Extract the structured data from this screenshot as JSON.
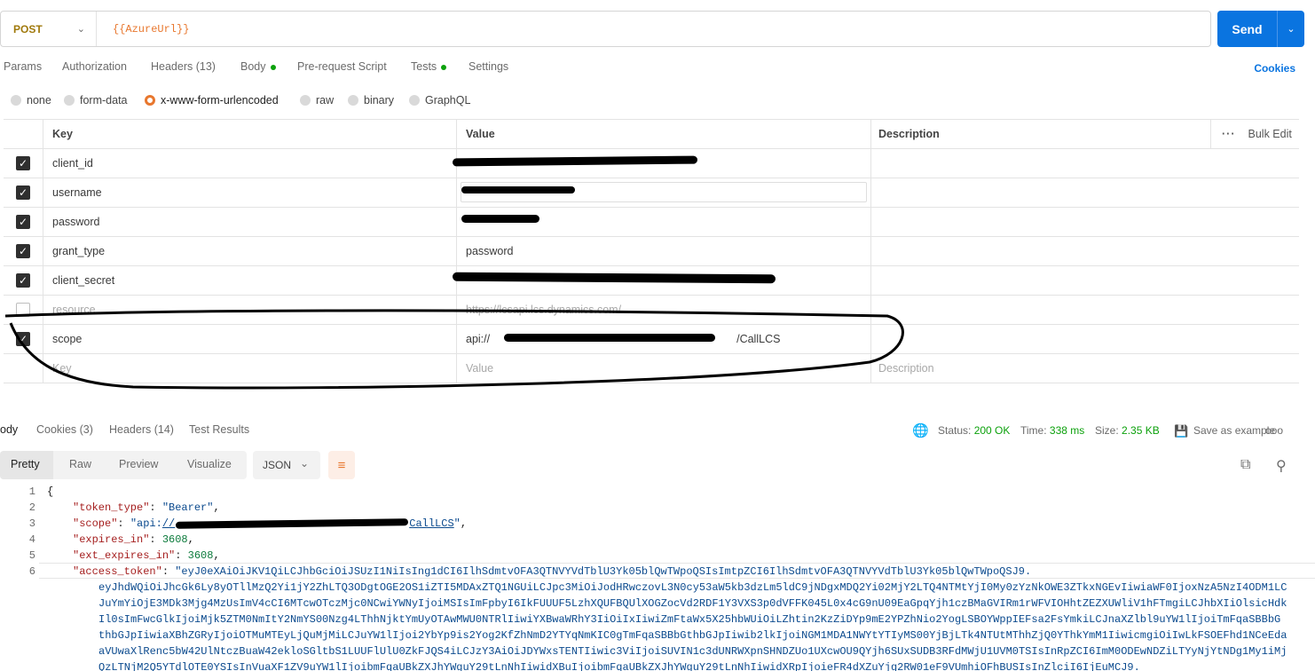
{
  "request": {
    "method": "POST",
    "url": "{{AzureUrl}}",
    "send_label": "Send"
  },
  "tabs": [
    {
      "label": "Params"
    },
    {
      "label": "Authorization"
    },
    {
      "label": "Headers (13)"
    },
    {
      "label": "Body"
    },
    {
      "label": "Pre-request Script"
    },
    {
      "label": "Tests"
    },
    {
      "label": "Settings"
    }
  ],
  "cookies_label": "Cookies",
  "body_types": [
    {
      "label": "none"
    },
    {
      "label": "form-data"
    },
    {
      "label": "x-www-form-urlencoded"
    },
    {
      "label": "raw"
    },
    {
      "label": "binary"
    },
    {
      "label": "GraphQL"
    }
  ],
  "table": {
    "headers": {
      "key": "Key",
      "value": "Value",
      "description": "Description",
      "bulk_edit": "Bulk Edit"
    },
    "rows": [
      {
        "key": "client_id",
        "value": ""
      },
      {
        "key": "username",
        "value": ""
      },
      {
        "key": "password",
        "value": ""
      },
      {
        "key": "grant_type",
        "value": "password"
      },
      {
        "key": "client_secret",
        "value": ""
      },
      {
        "key": "resource",
        "value": "https://lcsapi.lcs.dynamics.com/"
      },
      {
        "key": "scope",
        "value_prefix": "api://",
        "value_suffix": "/CallLCS"
      }
    ],
    "placeholder": {
      "key": "Key",
      "value": "Value",
      "description": "Description"
    }
  },
  "response": {
    "tabs": [
      {
        "label": "ody"
      },
      {
        "label": "Cookies (3)"
      },
      {
        "label": "Headers (14)"
      },
      {
        "label": "Test Results"
      }
    ],
    "status_label": "Status:",
    "status_value": "200 OK",
    "time_label": "Time:",
    "time_value": "338 ms",
    "size_label": "Size:",
    "size_value": "2.35 KB",
    "save_label": "Save as example",
    "more_label": "ooo",
    "views": [
      {
        "label": "Pretty"
      },
      {
        "label": "Raw"
      },
      {
        "label": "Preview"
      },
      {
        "label": "Visualize"
      }
    ],
    "format": "JSON"
  },
  "code": {
    "line_numbers": [
      "1",
      "2",
      "3",
      "4",
      "5",
      "6"
    ],
    "brace": "{",
    "token_type_key": "\"token_type\"",
    "token_type_val": "\"Bearer\"",
    "scope_key": "\"scope\"",
    "scope_val_prefix": "\"api:",
    "scope_val_link": "//",
    "scope_val_suffix": "CallLCS",
    "scope_val_end": "\"",
    "expires_in_key": "\"expires_in\"",
    "expires_in_val": "3608",
    "ext_expires_in_key": "\"ext_expires_in\"",
    "ext_expires_in_val": "3608",
    "access_token_key": "\"access_token\"",
    "token_lines": [
      "\"eyJ0eXAiOiJKV1QiLCJhbGciOiJSUzI1NiIsIng1dCI6IlhSdmtvOFA3QTNVYVdTblU3Yk05blQwTWpoQSIsImtpZCI6IlhSdmtvOFA3QTNVYVdTblU3Yk05blQwTWpoQSJ9.",
      "eyJhdWQiOiJhcGk6Ly8yOTllMzQ2Yi1jY2ZhLTQ3ODgtOGE2OS1iZTI5MDAxZTQ1NGUiLCJpc3MiOiJodHRwczovL3N0cy53aW5kb3dzLm5ldC9jNDgxMDQ2Yi02MjY2LTQ4NTMtYjI0My0zYzNkOWE3ZTkxNGEvIiwiaWF0IjoxNzA5NzI4ODM1LC",
      "JuYmYiOjE3MDk3Mjg4MzUsImV4cCI6MTcwOTczMjc0NCwiYWNyIjoiMSIsImFpbyI6IkFUUUF5LzhXQUFBQUlXOGZocVd2RDF1Y3VXS3p0dVFFK045L0x4cG9nU09EaGpqYjh1czBMaGVIRm1rWFVIOHhtZEZXUWliV1hFTmgiLCJhbXIiOlsicHdk",
      "Il0sImFwcGlkIjoiMjk5ZTM0NmItY2NmYS00Nzg4LThhNjktYmUyOTAwMWU0NTRlIiwiYXBwaWRhY3IiOiIxIiwiZmFtaWx5X25hbWUiOiLZhtin2KzZiDYp9mE2YPZhNio2YogLSBOYWppIEFsa2FsYmkiLCJnaXZlbl9uYW1lIjoiTmFqaSBBbG",
      "thbGJpIiwiaXBhZGRyIjoiOTMuMTEyLjQuMjMiLCJuYW1lIjoi2YbYp9is2Yog2KfZhNmD2YTYqNmKIC0gTmFqaSBBbGthbGJpIiwib2lkIjoiNGM1MDA1NWYtYTIyMS00YjBjLTk4NTUtMThhZjQ0YThkYmM1IiwicmgiOiIwLkFSOEFhd1NCeEda",
      "aVUwaXlRenc5bW42UlNtczBuaW42ekloSGltbS1LUUFlUlU0ZkFJQS4iLCJzY3AiOiJDYWxsTENTIiwic3ViIjoiSUVIN1c3dUNRWXpnSHNDZUo1UXcwOU9QYjh6SUxSUDB3RFdMWjU1UVM0TSIsInRpZCI6ImM0ODEwNDZiLTYyNjYtNDg1My1iMj",
      "QzLTNjM2Q5YTdlOTE0YSIsInVuaXF1ZV9uYW1lIjoibmFqaUBkZXJhYWguY29tLnNhIiwidXBuIjoibmFqaUBkZXJhYWguY29tLnNhIiwidXRpIjoieFR4dXZuYjg2RW01eF9VUmhiOFhBUSIsInZlciI6IjEuMCJ9."
    ]
  }
}
